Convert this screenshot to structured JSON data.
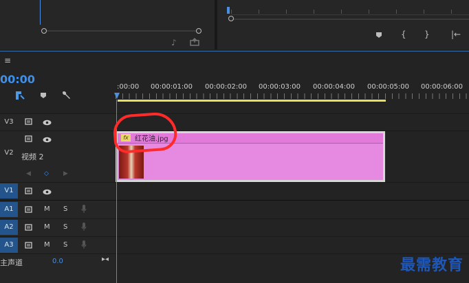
{
  "program_monitor": {
    "icons": [
      "marker-icon",
      "mark-in-icon",
      "mark-out-icon",
      "go-to-in-icon"
    ]
  },
  "source_monitor": {
    "icons": [
      "insert-icon",
      "export-frame-icon"
    ]
  },
  "timeline": {
    "menu_icon": "≡",
    "timecode": "00:00",
    "tools": {
      "snap": "snap-icon",
      "marker": "marker-icon",
      "wrench": "wrench-icon"
    },
    "ruler": [
      ":00:00",
      "00:00:01:00",
      "00:00:02:00",
      "00:00:03:00",
      "00:00:04:00",
      "00:00:05:00",
      "00:00:06:00"
    ],
    "tracks": {
      "v3": {
        "label": "V3"
      },
      "v2": {
        "label": "V2",
        "name": "视频 2"
      },
      "v1": {
        "label": "V1"
      },
      "a1": {
        "label": "A1",
        "m": "M",
        "s": "S"
      },
      "a2": {
        "label": "A2",
        "m": "M",
        "s": "S"
      },
      "a3": {
        "label": "A3",
        "m": "M",
        "s": "S"
      }
    },
    "master": {
      "label": "主声道",
      "value": "0.0"
    },
    "clip": {
      "fx": "fx",
      "name": "红花油.jpg"
    }
  },
  "watermark": "最需教育",
  "colors": {
    "accent_blue": "#23558c",
    "clip_pink": "#e58ae0",
    "work_area_yellow": "#e8e05a",
    "annotation_red": "#ff2b2b",
    "watermark_blue": "#1e57b8"
  }
}
